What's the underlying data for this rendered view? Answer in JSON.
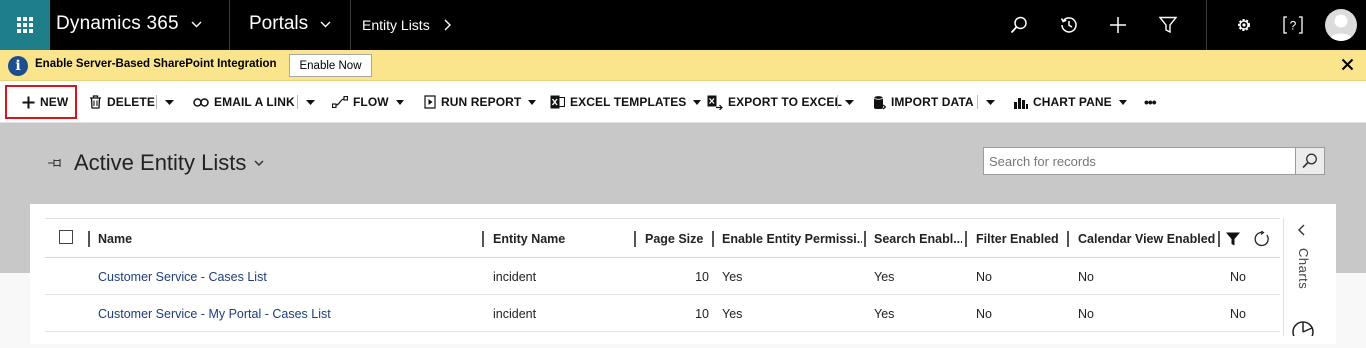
{
  "nav": {
    "app_title": "Dynamics 365",
    "area": "Portals",
    "breadcrumb": "Entity Lists",
    "icons": [
      "waffle-icon",
      "search-icon",
      "history-icon",
      "plus-icon",
      "filter-icon",
      "gear-icon",
      "help-icon",
      "avatar-icon"
    ],
    "accent": "#1e7f8a"
  },
  "notification": {
    "text": "Enable Server-Based SharePoint Integration",
    "button": "Enable Now",
    "background": "#fbe58c"
  },
  "commands": {
    "new": "NEW",
    "delete": "DELETE",
    "email_link": "EMAIL A LINK",
    "flow": "FLOW",
    "run_report": "RUN REPORT",
    "excel_templates": "EXCEL TEMPLATES",
    "export_excel": "EXPORT TO EXCEL",
    "import_data": "IMPORT DATA",
    "chart_pane": "CHART PANE",
    "more": "•••",
    "highlight_color": "#d8141c"
  },
  "view": {
    "title": "Active Entity Lists",
    "search_placeholder": "Search for records"
  },
  "grid": {
    "columns": [
      "Name",
      "Entity Name",
      "Page Size",
      "Enable Entity Permissi...",
      "Search Enabl...",
      "Filter Enabled",
      "Calendar View Enabled"
    ],
    "rows": [
      {
        "name": "Customer Service - Cases List",
        "entity": "incident",
        "page_size": "10",
        "permissions": "Yes",
        "search": "Yes",
        "filter": "No",
        "calendar": "No",
        "last": "No"
      },
      {
        "name": "Customer Service - My Portal - Cases List",
        "entity": "incident",
        "page_size": "10",
        "permissions": "Yes",
        "search": "Yes",
        "filter": "No",
        "calendar": "No",
        "last": "No"
      }
    ]
  },
  "side": {
    "charts_label": "Charts"
  }
}
